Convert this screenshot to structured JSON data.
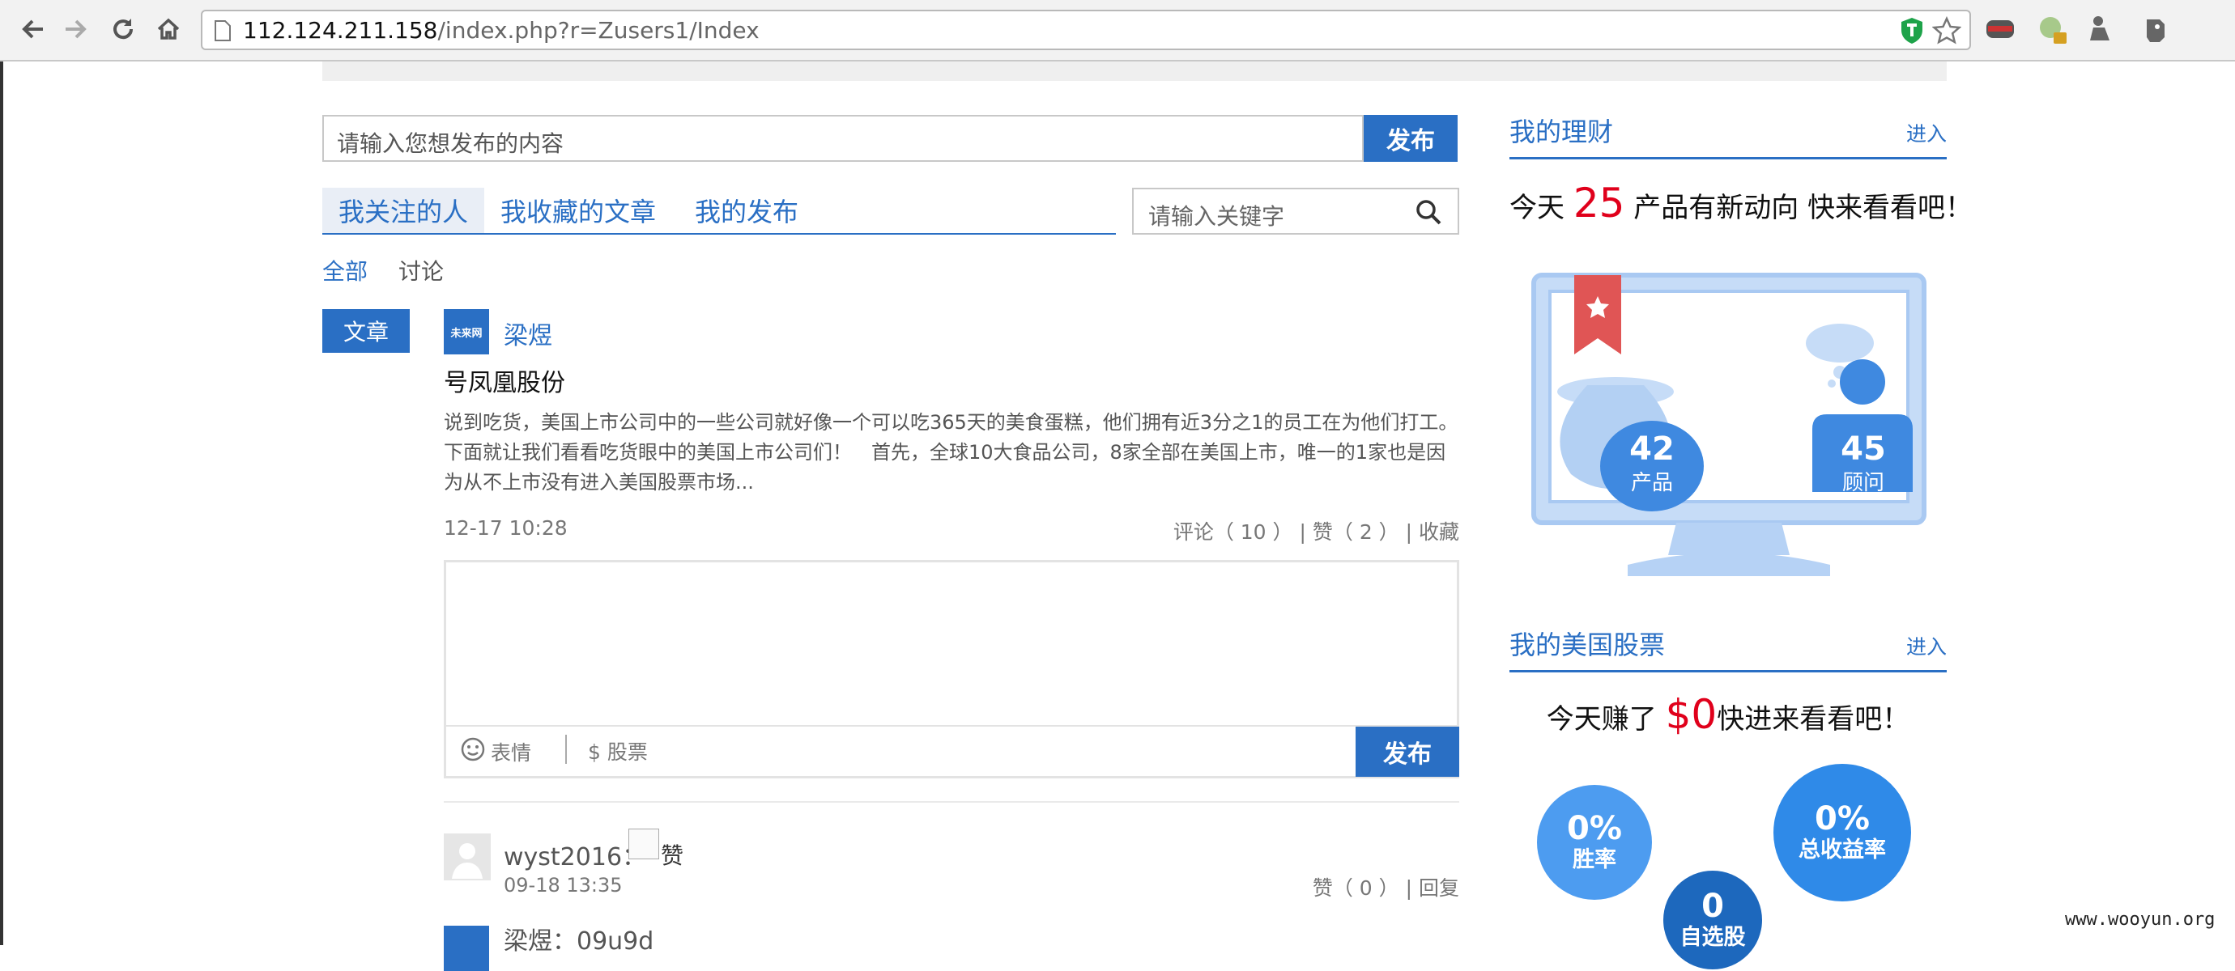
{
  "browser": {
    "url_host": "112.124.211.158",
    "url_path": "/index.php?r=Zusers1/Index"
  },
  "composer": {
    "placeholder": "请输入您想发布的内容",
    "submit_label": "发布"
  },
  "tabs": [
    {
      "label": "我关注的人"
    },
    {
      "label": "我收藏的文章"
    },
    {
      "label": "我的发布"
    }
  ],
  "search": {
    "placeholder": "请输入关键字"
  },
  "filters": {
    "all": "全部",
    "discussion": "讨论"
  },
  "feed": {
    "type_tag": "文章",
    "avatar_text": "未来网",
    "author": "梁煜",
    "title": "号凤凰股份",
    "body": "说到吃货，美国上市公司中的一些公司就好像一个可以吃365天的美食蛋糕，他们拥有近3分之1的员工在为他们打工。下面就让我们看看吃货眼中的美国上市公司们！　首先，全球10大食品公司，8家全部在美国上市，唯一的1家也是因为从不上市没有进入美国股票市场...",
    "time": "12-17 10:28",
    "comment_label": "评论（ 10 ）",
    "like_label": "| 赞（ 2 ）",
    "favorite_label": "| 收藏"
  },
  "comment_box": {
    "emoji_label": "表情",
    "stock_label": "$ 股票",
    "send_label": "发布"
  },
  "comments": [
    {
      "user": "wyst2016：",
      "image_alt": "赞",
      "time": "09-18 13:35",
      "like_label": "赞（ 0 ）",
      "reply_label": "| 回复"
    },
    {
      "user": "梁煜：09u9d"
    }
  ],
  "sidebar": {
    "wealth": {
      "title": "我的理财",
      "enter": "进入",
      "msg_pre": "今天 ",
      "msg_num": "25",
      "msg_post": " 产品有新动向 快来看看吧！",
      "products_value": "42",
      "products_label": "产品",
      "advisors_value": "45",
      "advisors_label": "顾问"
    },
    "stocks": {
      "title": "我的美国股票",
      "enter": "进入",
      "msg_pre": "今天赚了 ",
      "msg_num": "$0",
      "msg_post": "快进来看看吧！",
      "win_rate_value": "0%",
      "win_rate_label": "胜率",
      "total_return_value": "0%",
      "total_return_label": "总收益率",
      "self_pick_value": "0",
      "self_pick_label": "自选股"
    }
  },
  "watermark": "www.wooyun.org",
  "colors": {
    "accent": "#2a6fc4",
    "highlight": "#e0001b"
  },
  "icons": [
    "back-arrow-icon",
    "forward-arrow-icon",
    "reload-icon",
    "home-icon",
    "page-icon",
    "shield-icon",
    "star-icon",
    "mask-icon",
    "green-dot-icon",
    "robot-icon",
    "elephant-icon",
    "search-icon",
    "smiley-icon"
  ]
}
